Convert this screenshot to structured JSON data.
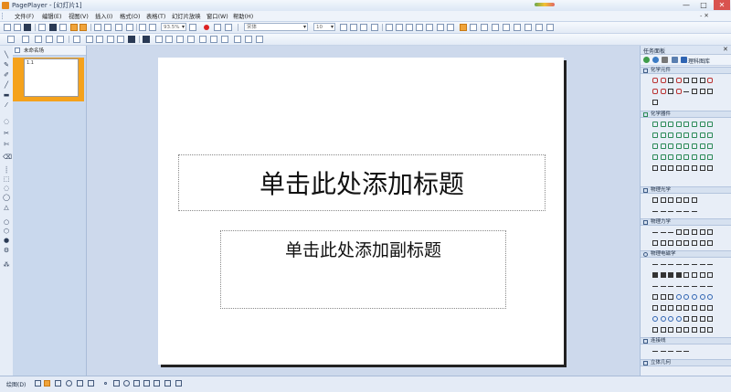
{
  "window": {
    "title": "PagePlayer - [幻灯片1]",
    "minimize_glyph": "—",
    "maximize_glyph": "□",
    "close_glyph": "✕"
  },
  "menu": {
    "items": [
      "文件(F)",
      "编辑(E)",
      "视图(V)",
      "插入(I)",
      "格式(O)",
      "表格(T)",
      "幻灯片放映",
      "窗口(W)",
      "帮助(H)"
    ],
    "right_controls": "- ✕"
  },
  "toolbar1": {
    "zoom_value": "93.5%",
    "font_name_placeholder": "宋体",
    "font_size_placeholder": "10"
  },
  "slides_panel": {
    "tab_label": "未命名场",
    "thumb_number": "1.1"
  },
  "slide": {
    "title_placeholder": "单击此处添加标题",
    "subtitle_placeholder": "单击此处添加副标题"
  },
  "task_pane": {
    "title": "任务面板",
    "close_glyph": "✕",
    "nav_label": "理科图库",
    "sections": [
      "化学元件",
      "化学器件",
      "物理光学",
      "物理力学",
      "物理电磁学",
      "连接线",
      "立体几何"
    ]
  },
  "statusbar": {
    "draw_label": "绘图(D)"
  },
  "colors": {
    "accent_orange": "#f5a21c",
    "workspace_blue": "#cdd9ec"
  }
}
